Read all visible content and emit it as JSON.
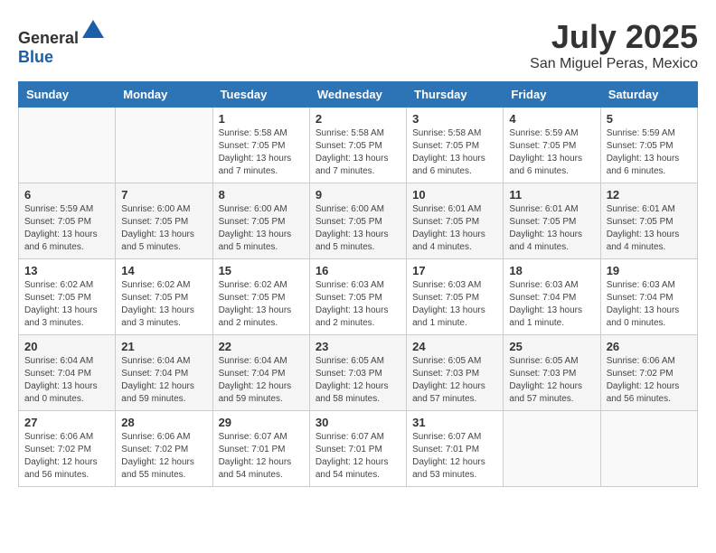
{
  "header": {
    "logo_general": "General",
    "logo_blue": "Blue",
    "month_title": "July 2025",
    "location": "San Miguel Peras, Mexico"
  },
  "weekdays": [
    "Sunday",
    "Monday",
    "Tuesday",
    "Wednesday",
    "Thursday",
    "Friday",
    "Saturday"
  ],
  "weeks": [
    [
      {
        "day": "",
        "info": ""
      },
      {
        "day": "",
        "info": ""
      },
      {
        "day": "1",
        "info": "Sunrise: 5:58 AM\nSunset: 7:05 PM\nDaylight: 13 hours and 7 minutes."
      },
      {
        "day": "2",
        "info": "Sunrise: 5:58 AM\nSunset: 7:05 PM\nDaylight: 13 hours and 7 minutes."
      },
      {
        "day": "3",
        "info": "Sunrise: 5:58 AM\nSunset: 7:05 PM\nDaylight: 13 hours and 6 minutes."
      },
      {
        "day": "4",
        "info": "Sunrise: 5:59 AM\nSunset: 7:05 PM\nDaylight: 13 hours and 6 minutes."
      },
      {
        "day": "5",
        "info": "Sunrise: 5:59 AM\nSunset: 7:05 PM\nDaylight: 13 hours and 6 minutes."
      }
    ],
    [
      {
        "day": "6",
        "info": "Sunrise: 5:59 AM\nSunset: 7:05 PM\nDaylight: 13 hours and 6 minutes."
      },
      {
        "day": "7",
        "info": "Sunrise: 6:00 AM\nSunset: 7:05 PM\nDaylight: 13 hours and 5 minutes."
      },
      {
        "day": "8",
        "info": "Sunrise: 6:00 AM\nSunset: 7:05 PM\nDaylight: 13 hours and 5 minutes."
      },
      {
        "day": "9",
        "info": "Sunrise: 6:00 AM\nSunset: 7:05 PM\nDaylight: 13 hours and 5 minutes."
      },
      {
        "day": "10",
        "info": "Sunrise: 6:01 AM\nSunset: 7:05 PM\nDaylight: 13 hours and 4 minutes."
      },
      {
        "day": "11",
        "info": "Sunrise: 6:01 AM\nSunset: 7:05 PM\nDaylight: 13 hours and 4 minutes."
      },
      {
        "day": "12",
        "info": "Sunrise: 6:01 AM\nSunset: 7:05 PM\nDaylight: 13 hours and 4 minutes."
      }
    ],
    [
      {
        "day": "13",
        "info": "Sunrise: 6:02 AM\nSunset: 7:05 PM\nDaylight: 13 hours and 3 minutes."
      },
      {
        "day": "14",
        "info": "Sunrise: 6:02 AM\nSunset: 7:05 PM\nDaylight: 13 hours and 3 minutes."
      },
      {
        "day": "15",
        "info": "Sunrise: 6:02 AM\nSunset: 7:05 PM\nDaylight: 13 hours and 2 minutes."
      },
      {
        "day": "16",
        "info": "Sunrise: 6:03 AM\nSunset: 7:05 PM\nDaylight: 13 hours and 2 minutes."
      },
      {
        "day": "17",
        "info": "Sunrise: 6:03 AM\nSunset: 7:05 PM\nDaylight: 13 hours and 1 minute."
      },
      {
        "day": "18",
        "info": "Sunrise: 6:03 AM\nSunset: 7:04 PM\nDaylight: 13 hours and 1 minute."
      },
      {
        "day": "19",
        "info": "Sunrise: 6:03 AM\nSunset: 7:04 PM\nDaylight: 13 hours and 0 minutes."
      }
    ],
    [
      {
        "day": "20",
        "info": "Sunrise: 6:04 AM\nSunset: 7:04 PM\nDaylight: 13 hours and 0 minutes."
      },
      {
        "day": "21",
        "info": "Sunrise: 6:04 AM\nSunset: 7:04 PM\nDaylight: 12 hours and 59 minutes."
      },
      {
        "day": "22",
        "info": "Sunrise: 6:04 AM\nSunset: 7:04 PM\nDaylight: 12 hours and 59 minutes."
      },
      {
        "day": "23",
        "info": "Sunrise: 6:05 AM\nSunset: 7:03 PM\nDaylight: 12 hours and 58 minutes."
      },
      {
        "day": "24",
        "info": "Sunrise: 6:05 AM\nSunset: 7:03 PM\nDaylight: 12 hours and 57 minutes."
      },
      {
        "day": "25",
        "info": "Sunrise: 6:05 AM\nSunset: 7:03 PM\nDaylight: 12 hours and 57 minutes."
      },
      {
        "day": "26",
        "info": "Sunrise: 6:06 AM\nSunset: 7:02 PM\nDaylight: 12 hours and 56 minutes."
      }
    ],
    [
      {
        "day": "27",
        "info": "Sunrise: 6:06 AM\nSunset: 7:02 PM\nDaylight: 12 hours and 56 minutes."
      },
      {
        "day": "28",
        "info": "Sunrise: 6:06 AM\nSunset: 7:02 PM\nDaylight: 12 hours and 55 minutes."
      },
      {
        "day": "29",
        "info": "Sunrise: 6:07 AM\nSunset: 7:01 PM\nDaylight: 12 hours and 54 minutes."
      },
      {
        "day": "30",
        "info": "Sunrise: 6:07 AM\nSunset: 7:01 PM\nDaylight: 12 hours and 54 minutes."
      },
      {
        "day": "31",
        "info": "Sunrise: 6:07 AM\nSunset: 7:01 PM\nDaylight: 12 hours and 53 minutes."
      },
      {
        "day": "",
        "info": ""
      },
      {
        "day": "",
        "info": ""
      }
    ]
  ]
}
